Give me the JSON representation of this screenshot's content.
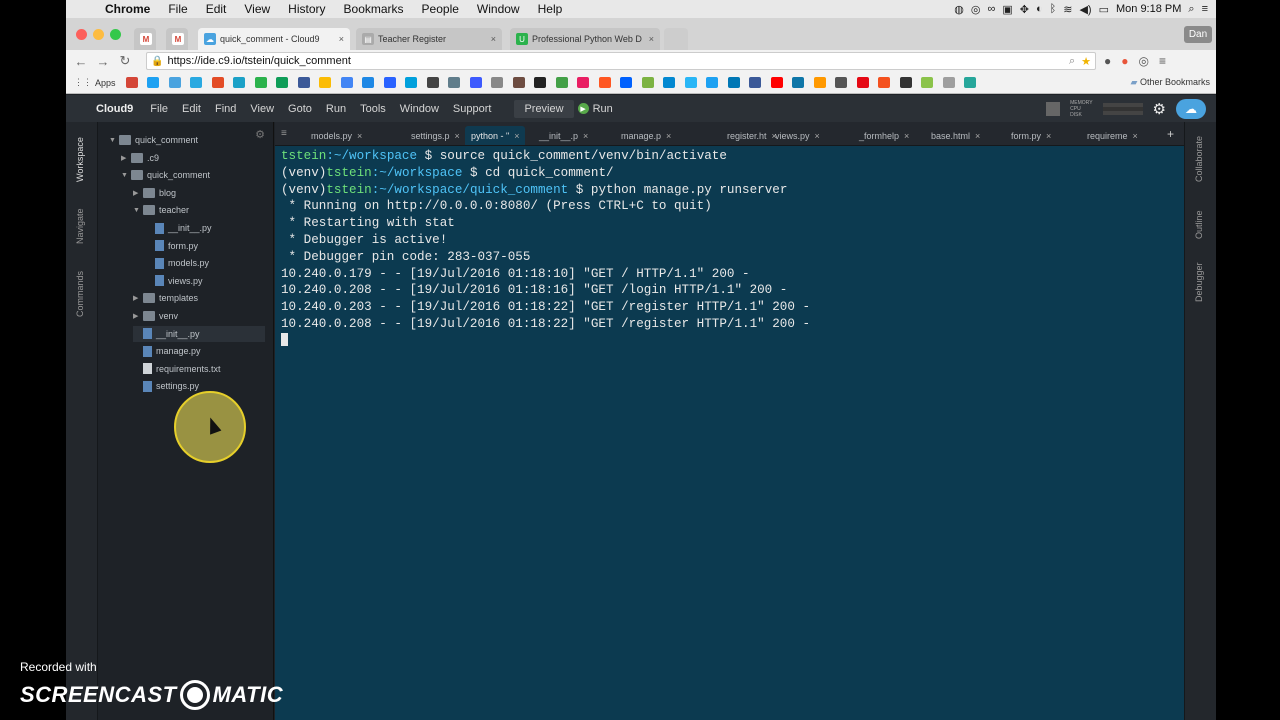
{
  "menubar": {
    "app": "Chrome",
    "items": [
      "File",
      "Edit",
      "View",
      "History",
      "Bookmarks",
      "People",
      "Window",
      "Help"
    ],
    "clock": "Mon 9:18 PM"
  },
  "browser": {
    "tabs": [
      {
        "title": "quick_comment - Cloud9",
        "active": true
      },
      {
        "title": "Teacher Register",
        "active": false
      },
      {
        "title": "Professional Python Web D",
        "active": false
      }
    ],
    "profile": "Dan",
    "url": "https://ide.c9.io/tstein/quick_comment",
    "bookmarks_apps": "Apps",
    "other_bookmarks": "Other Bookmarks"
  },
  "ide": {
    "logo": "Cloud9",
    "menu": [
      "File",
      "Edit",
      "Find",
      "View",
      "Goto",
      "Run",
      "Tools",
      "Window",
      "Support"
    ],
    "preview": "Preview",
    "run": "Run",
    "meter_labels": [
      "MEMORY",
      "CPU",
      "DISK"
    ],
    "left_panels": [
      "Workspace",
      "Navigate",
      "Commands"
    ],
    "right_panels": [
      "Collaborate",
      "Outline",
      "Debugger"
    ]
  },
  "tree": [
    {
      "label": "quick_comment",
      "type": "folder",
      "depth": 0,
      "arrow": "▼"
    },
    {
      "label": ".c9",
      "type": "folder",
      "depth": 1,
      "arrow": "▶"
    },
    {
      "label": "quick_comment",
      "type": "folder",
      "depth": 1,
      "arrow": "▼"
    },
    {
      "label": "blog",
      "type": "folder",
      "depth": 2,
      "arrow": "▶"
    },
    {
      "label": "teacher",
      "type": "folder",
      "depth": 2,
      "arrow": "▼"
    },
    {
      "label": "__init__.py",
      "type": "py",
      "depth": 3,
      "arrow": ""
    },
    {
      "label": "form.py",
      "type": "py",
      "depth": 3,
      "arrow": ""
    },
    {
      "label": "models.py",
      "type": "py",
      "depth": 3,
      "arrow": ""
    },
    {
      "label": "views.py",
      "type": "py",
      "depth": 3,
      "arrow": ""
    },
    {
      "label": "templates",
      "type": "folder",
      "depth": 2,
      "arrow": "▶"
    },
    {
      "label": "venv",
      "type": "folder",
      "depth": 2,
      "arrow": "▶"
    },
    {
      "label": "__init__.py",
      "type": "py",
      "depth": 2,
      "arrow": "",
      "selected": true
    },
    {
      "label": "manage.py",
      "type": "py",
      "depth": 2,
      "arrow": ""
    },
    {
      "label": "requirements.txt",
      "type": "file",
      "depth": 2,
      "arrow": ""
    },
    {
      "label": "settings.py",
      "type": "py",
      "depth": 2,
      "arrow": ""
    }
  ],
  "editor_tabs": [
    {
      "label": "models.py",
      "active": false
    },
    {
      "label": "settings.p",
      "active": false
    },
    {
      "label": "python - \"",
      "active": true
    },
    {
      "label": "__init__.p",
      "active": false
    },
    {
      "label": "manage.p",
      "active": false
    },
    {
      "label": "register.ht",
      "active": false
    },
    {
      "label": "views.py",
      "active": false
    },
    {
      "label": "_formhelp",
      "active": false
    },
    {
      "label": "base.html",
      "active": false
    },
    {
      "label": "form.py",
      "active": false
    },
    {
      "label": "requireme",
      "active": false
    }
  ],
  "terminal": {
    "prompts": [
      {
        "venv": "",
        "user": "tstein",
        "path": ":~/workspace",
        "cmd": " $ source quick_comment/venv/bin/activate"
      },
      {
        "venv": "(venv)",
        "user": "tstein",
        "path": ":~/workspace",
        "cmd": " $ cd quick_comment/"
      },
      {
        "venv": "(venv)",
        "user": "tstein",
        "path": ":~/workspace/quick_comment",
        "cmd": " $ python manage.py runserver"
      }
    ],
    "output": [
      " * Running on http://0.0.0.0:8080/ (Press CTRL+C to quit)",
      " * Restarting with stat",
      " * Debugger is active!",
      " * Debugger pin code: 283-037-055",
      "10.240.0.179 - - [19/Jul/2016 01:18:10] \"GET / HTTP/1.1\" 200 -",
      "10.240.0.208 - - [19/Jul/2016 01:18:16] \"GET /login HTTP/1.1\" 200 -",
      "10.240.0.203 - - [19/Jul/2016 01:18:22] \"GET /register HTTP/1.1\" 200 -",
      "10.240.0.208 - - [19/Jul/2016 01:18:22] \"GET /register HTTP/1.1\" 200 -"
    ]
  },
  "watermark": {
    "recorded": "Recorded with",
    "brand_left": "SCREENCAST",
    "brand_right": "MATIC"
  },
  "colors": {
    "terminal_bg": "#0c3a50",
    "prompt_user": "#6ee07a",
    "prompt_path": "#4fc3f7",
    "cursor_highlight": "#ffee5a"
  }
}
